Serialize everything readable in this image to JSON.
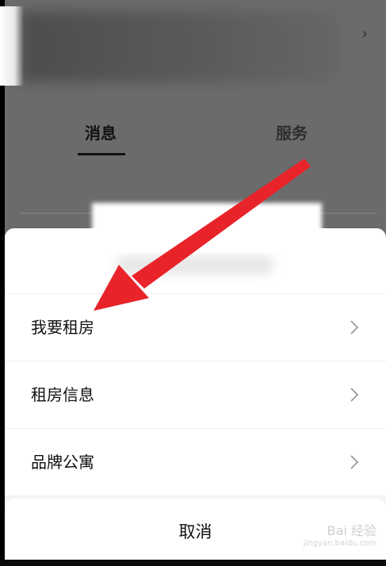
{
  "background": {
    "tabs": [
      {
        "label": "消息",
        "active": true
      },
      {
        "label": "服务",
        "active": false
      }
    ]
  },
  "menu": {
    "items": [
      {
        "label": "我要租房"
      },
      {
        "label": "租房信息"
      },
      {
        "label": "品牌公寓"
      }
    ],
    "cancel_label": "取消"
  },
  "watermark": {
    "text": "Bai 经验",
    "domain": "jingyan.baidu.com"
  },
  "colors": {
    "arrow": "#e8232a",
    "overlay": "#6b6b6b",
    "sheet": "#ffffff"
  },
  "icons": {
    "chevron": "chevron-right-icon",
    "arrow": "red-arrow-annotation"
  }
}
